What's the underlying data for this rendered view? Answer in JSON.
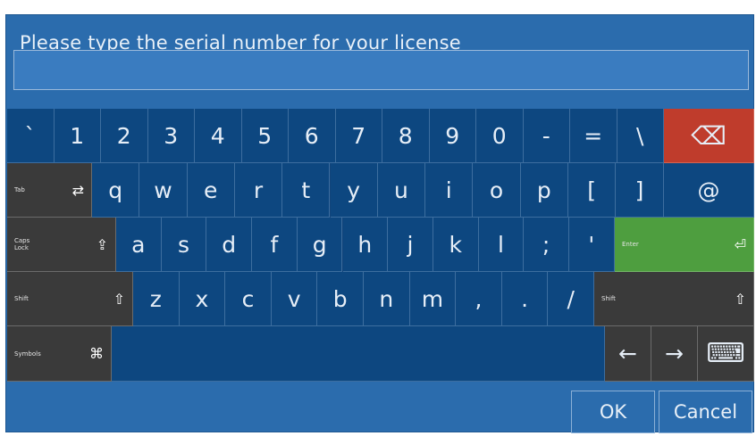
{
  "dialog": {
    "prompt": "Please type the serial number for your license",
    "input_value": ""
  },
  "keyboard": {
    "row1": [
      "`",
      "1",
      "2",
      "3",
      "4",
      "5",
      "6",
      "7",
      "8",
      "9",
      "0",
      "-",
      "=",
      "\\"
    ],
    "row2": [
      "q",
      "w",
      "e",
      "r",
      "t",
      "y",
      "u",
      "i",
      "o",
      "p",
      "[",
      "]"
    ],
    "row3": [
      "a",
      "s",
      "d",
      "f",
      "g",
      "h",
      "j",
      "k",
      "l",
      ";",
      "'"
    ],
    "row4": [
      "z",
      "x",
      "c",
      "v",
      "b",
      "n",
      "m",
      ",",
      ".",
      "/"
    ],
    "special": {
      "backspace_icon": "⌫",
      "tab_label": "Tab",
      "tab_icon": "⇄",
      "at_key": "@",
      "caps_label": "Caps\nLock",
      "caps_icon": "⇪",
      "enter_label": "Enter",
      "enter_icon": "⏎",
      "shift_label": "Shift",
      "shift_icon": "⇧",
      "symbols_label": "Symbols",
      "symbols_icon": "⌘",
      "left_arrow": "←",
      "right_arrow": "→",
      "keyboard_icon": "⌨"
    }
  },
  "buttons": {
    "ok": "OK",
    "cancel": "Cancel"
  },
  "colors": {
    "dialog_bg": "#2b6cad",
    "key_bg": "#0d4780",
    "modifier_bg": "#3a3a3a",
    "backspace_bg": "#bf3c2c",
    "enter_bg": "#4e9e3f"
  }
}
